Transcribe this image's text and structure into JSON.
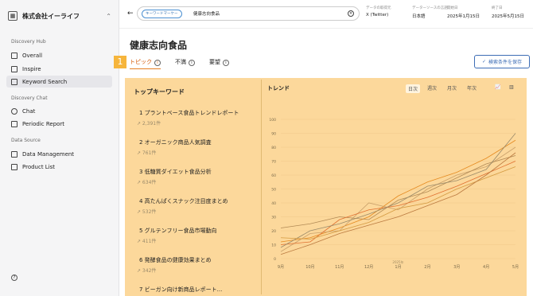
{
  "brand": {
    "name": "株式会社イーライフ"
  },
  "sidebar": {
    "section_hub": "Discovery Hub",
    "items": [
      {
        "label": "Overall"
      },
      {
        "label": "Inspire"
      },
      {
        "label": "Keyword Search"
      }
    ],
    "section_chat": "Discovery Chat",
    "chat_items": [
      {
        "label": "Chat"
      },
      {
        "label": "Periodic Report"
      }
    ],
    "section_data": "Data Source",
    "data_items": [
      {
        "label": "Data Management"
      },
      {
        "label": "Product List"
      }
    ]
  },
  "search": {
    "chip": "キーワードマーケー",
    "query": "健康志向食品"
  },
  "filters": [
    {
      "label": "データの取得元",
      "value": "X (Twitter)"
    },
    {
      "label": "データーソースの言語",
      "value": "日本語"
    },
    {
      "label": "開始日",
      "value": "2025年1月15日"
    },
    {
      "label": "終了日",
      "value": "2025年5月15日"
    }
  ],
  "page": {
    "title": "健康志向食品",
    "badge": "1",
    "save": "検索条件を保存"
  },
  "tabs": [
    {
      "label": "トピック"
    },
    {
      "label": "不満"
    },
    {
      "label": "要望"
    }
  ],
  "topics": {
    "title": "トップキーワード",
    "items": [
      {
        "rank": "1",
        "label": "プラントベース食品トレンドレポート",
        "count": "2,391件"
      },
      {
        "rank": "2",
        "label": "オーガニック商品人気調査",
        "count": "761件"
      },
      {
        "rank": "3",
        "label": "低糖質ダイエット食品分析",
        "count": "634件"
      },
      {
        "rank": "4",
        "label": "高たんぱくスナック注目度まとめ",
        "count": "532件"
      },
      {
        "rank": "5",
        "label": "グルテンフリー食品市場動向",
        "count": "411件"
      },
      {
        "rank": "6",
        "label": "発酵食品の健康効果まとめ",
        "count": "342件"
      },
      {
        "rank": "7",
        "label": "ビーガン向け新商品レポート...",
        "count": ""
      }
    ]
  },
  "trend": {
    "title": "トレンド",
    "periods": [
      "日次",
      "週次",
      "月次",
      "年次"
    ]
  },
  "chart_data": {
    "type": "line",
    "x": [
      "9月",
      "10月",
      "11月",
      "12月",
      "1月",
      "2月",
      "3月",
      "4月",
      "5月"
    ],
    "x_year_label": "2025年",
    "ylim": [
      0,
      100
    ],
    "yticks": [
      0,
      10,
      20,
      30,
      40,
      50,
      60,
      70,
      80,
      90,
      100
    ],
    "series": [
      {
        "values": [
          12,
          15,
          22,
          30,
          45,
          55,
          62,
          72,
          85
        ]
      },
      {
        "values": [
          5,
          18,
          20,
          40,
          35,
          50,
          60,
          66,
          80
        ]
      },
      {
        "values": [
          22,
          25,
          30,
          28,
          42,
          48,
          58,
          68,
          74
        ]
      },
      {
        "values": [
          10,
          12,
          28,
          35,
          38,
          44,
          52,
          61,
          70
        ]
      },
      {
        "values": [
          8,
          20,
          25,
          32,
          40,
          52,
          56,
          64,
          90
        ]
      },
      {
        "values": [
          15,
          14,
          20,
          26,
          36,
          40,
          50,
          58,
          66
        ]
      },
      {
        "values": [
          3,
          10,
          18,
          24,
          30,
          38,
          46,
          60,
          76
        ]
      }
    ]
  }
}
